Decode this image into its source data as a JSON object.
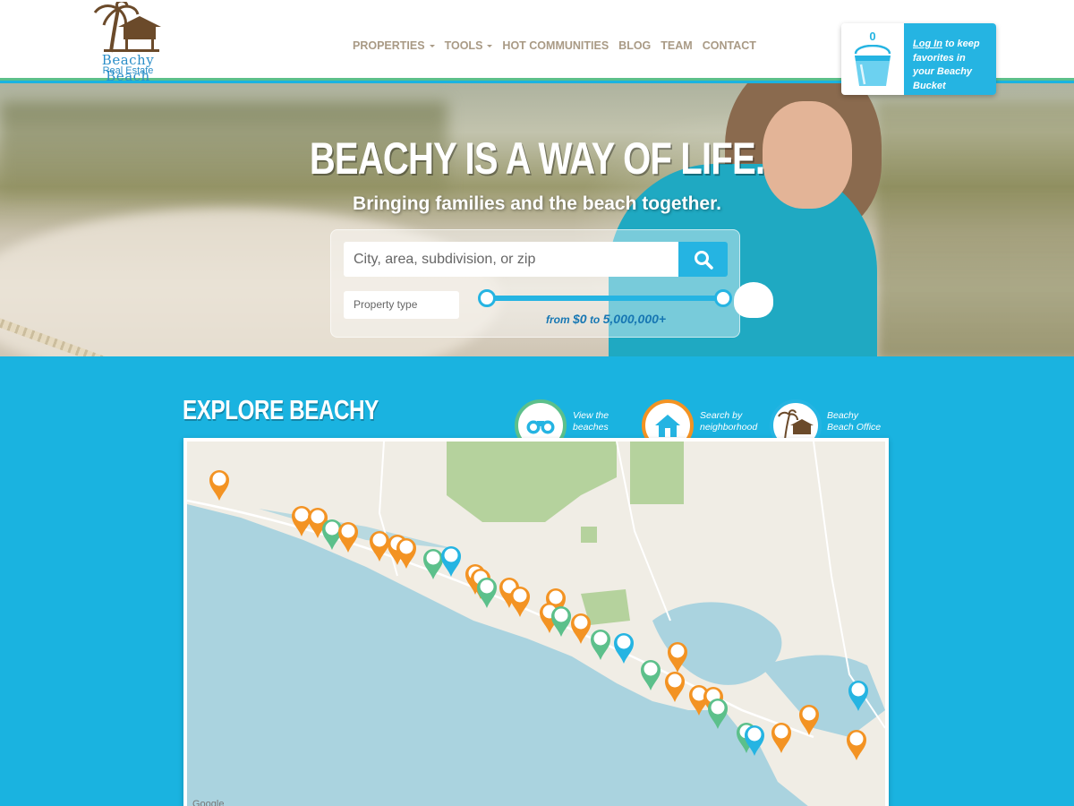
{
  "header": {
    "logo_name": "Beachy Beach",
    "logo_sub": "Real Estate",
    "nav": [
      {
        "label": "PROPERTIES",
        "dropdown": true
      },
      {
        "label": "TOOLS",
        "dropdown": true
      },
      {
        "label": "HOT COMMUNITIES",
        "dropdown": false
      },
      {
        "label": "BLOG",
        "dropdown": false
      },
      {
        "label": "TEAM",
        "dropdown": false
      },
      {
        "label": "CONTACT",
        "dropdown": false
      }
    ],
    "bucket": {
      "count": "0",
      "login_link": "Log In",
      "text": " to keep favorites in your Beachy Bucket"
    }
  },
  "hero": {
    "title": "BEACHY IS A WAY OF LIFE.",
    "subtitle": "Bringing families and the beach together.",
    "search_placeholder": "City, area, subdivision, or zip",
    "property_type_placeholder": "Property type",
    "price_from_label": "from",
    "price_min": "$0",
    "price_to_label": "to",
    "price_max": "5,000,000+"
  },
  "explore": {
    "title": "EXPLORE BEACHY",
    "categories": [
      {
        "label_line1": "View the",
        "label_line2": "beaches",
        "icon": "binoculars-icon",
        "color": "#5cc08b"
      },
      {
        "label_line1": "Search by",
        "label_line2": "neighborhood",
        "icon": "house-icon",
        "color": "#f39323"
      },
      {
        "label_line1": "Beachy",
        "label_line2": "Beach Office",
        "icon": "hut-icon",
        "color": "#25b4e2"
      }
    ]
  },
  "map": {
    "attribution": "Google",
    "colors": {
      "water": "#aad3df",
      "land": "#f0ede5",
      "park": "#b5d29d",
      "neighborhood": "#f39323",
      "beach": "#5cc08b",
      "office": "#25b4e2"
    }
  },
  "colors": {
    "accent": "#25b4e2",
    "page_bg": "#1ab3e0",
    "header_border": "#5cc08b",
    "nav_text": "#a99a85"
  }
}
